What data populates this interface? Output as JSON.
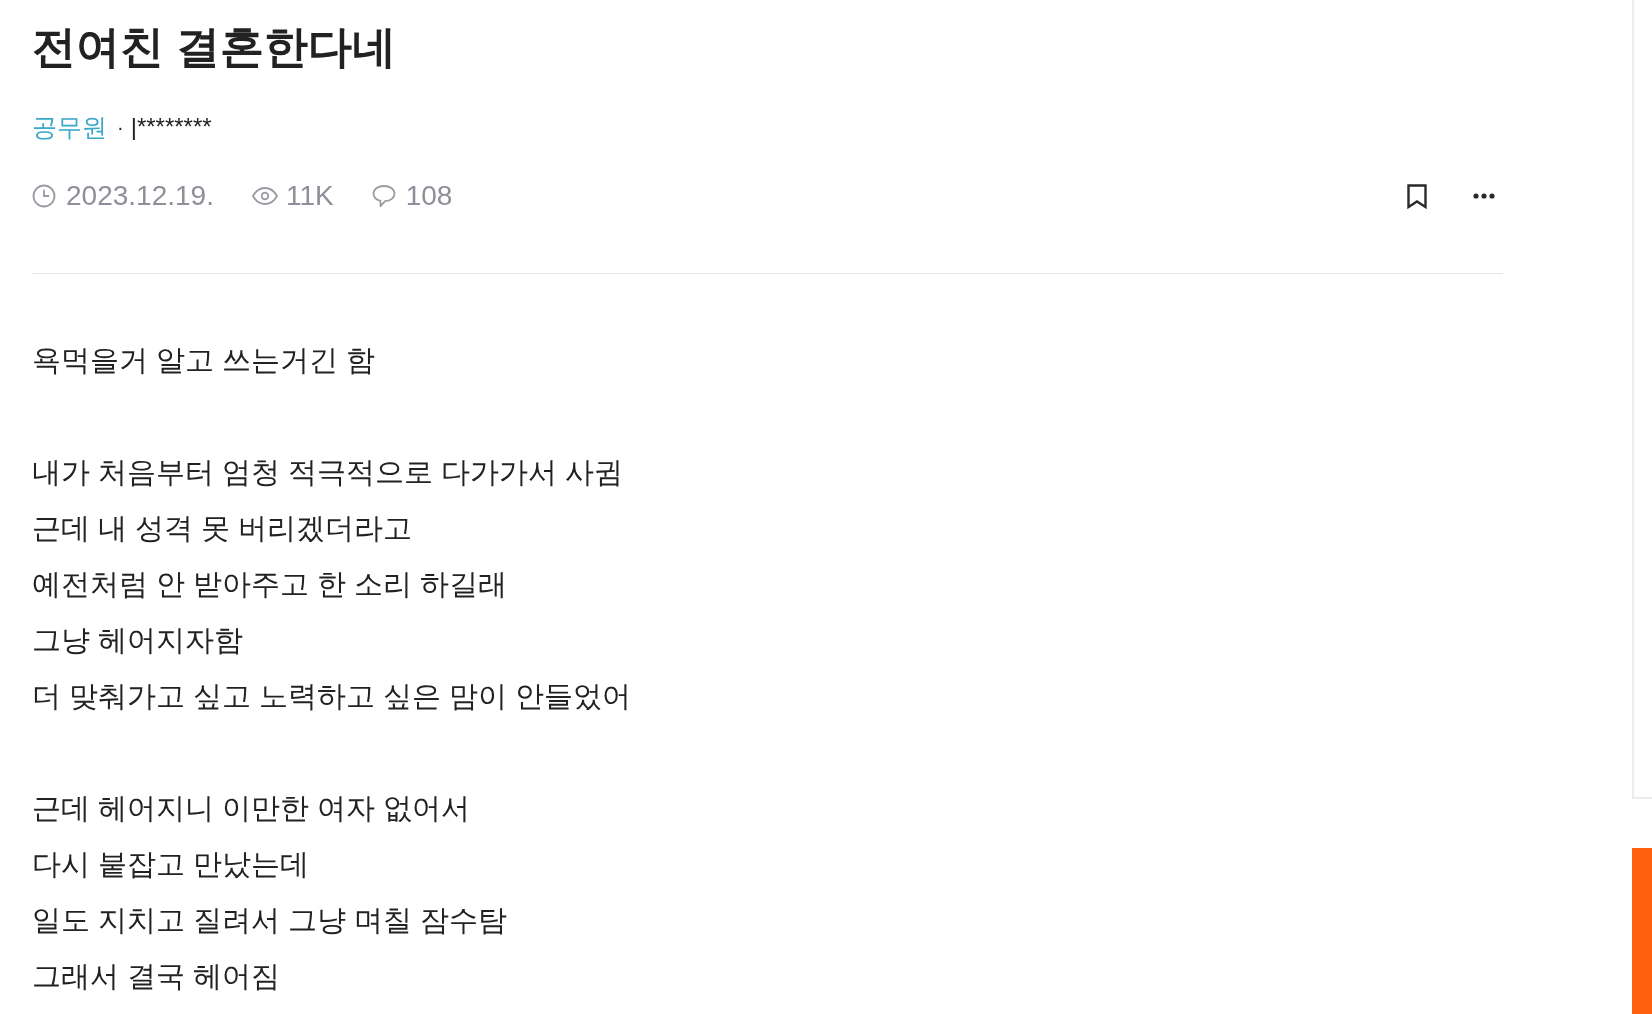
{
  "post": {
    "title": "전여친 결혼한다네",
    "author": {
      "category": "공무원",
      "separator": "·",
      "user_id": "|********"
    },
    "meta": {
      "date": "2023.12.19.",
      "views": "11K",
      "comments": "108"
    },
    "body": [
      {
        "lines": [
          "욕먹을거 알고 쓰는거긴 함"
        ]
      },
      {
        "lines": [
          "내가 처음부터 엄청 적극적으로 다가가서 사귐",
          "근데 내 성격 못 버리겠더라고",
          "예전처럼 안 받아주고 한 소리 하길래",
          "그냥 헤어지자함",
          "더 맞춰가고 싶고 노력하고 싶은 맘이 안들었어"
        ]
      },
      {
        "lines": [
          "근데 헤어지니 이만한 여자 없어서",
          "다시 붙잡고 만났는데",
          "일도 지치고 질려서 그냥 며칠 잠수탐",
          "그래서 결국 헤어짐"
        ]
      }
    ]
  }
}
